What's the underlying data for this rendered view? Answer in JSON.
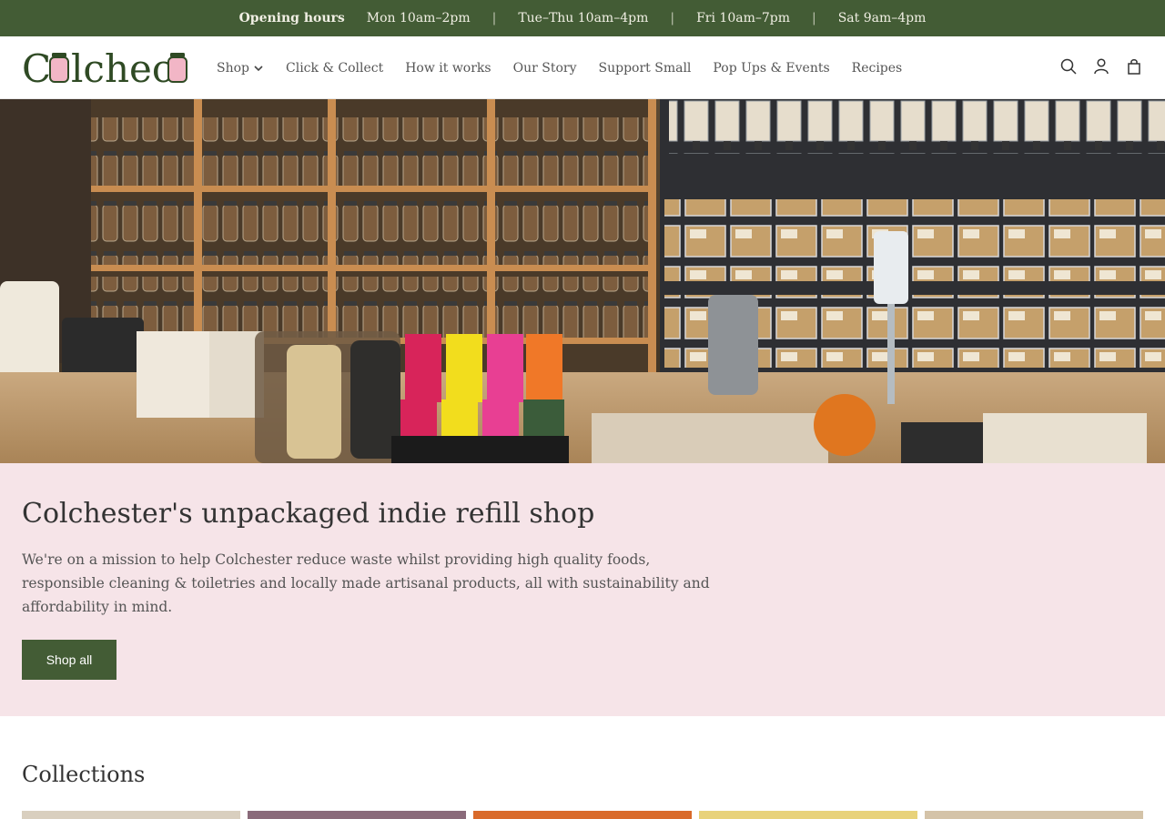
{
  "announcement": {
    "lead": "Opening hours",
    "items": [
      "Mon 10am–2pm",
      "Tue–Thu 10am–4pm",
      "Fri 10am–7pm",
      "Sat 9am–4pm"
    ]
  },
  "brand": {
    "logo_text": "Colchec"
  },
  "nav": {
    "items": [
      "Shop",
      "Click & Collect",
      "How it works",
      "Our Story",
      "Support Small",
      "Pop Ups & Events",
      "Recipes"
    ]
  },
  "header_icons": [
    "search-icon",
    "account-icon",
    "cart-icon"
  ],
  "hero_image": {
    "alt": ""
  },
  "intro": {
    "title": "Colchester's unpackaged indie refill shop",
    "text": "We're on a mission to help Colchester reduce waste whilst providing high quality foods, responsible cleaning & toiletries and locally made artisanal products, all with sustainability and affordability in mind.",
    "button": "Shop all"
  },
  "collections": {
    "title": "Collections"
  },
  "colors": {
    "brand_green": "#435c35",
    "pink": "#f6e4e8",
    "logo_pink": "#f2b6c6"
  }
}
